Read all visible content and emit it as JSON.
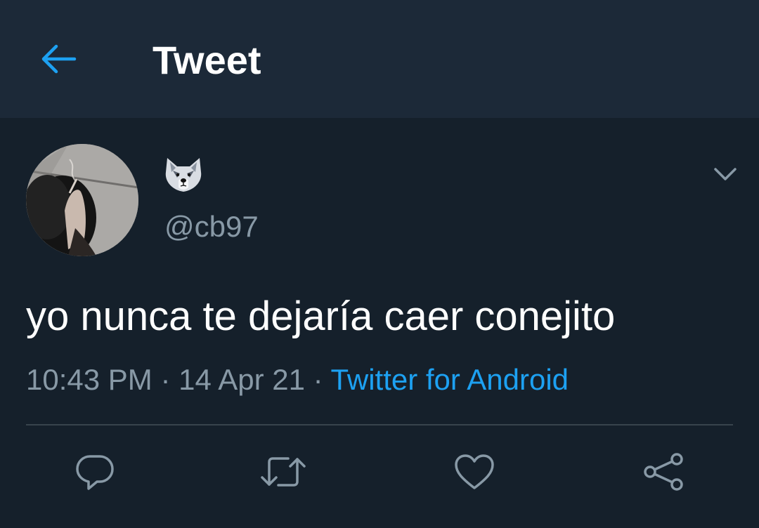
{
  "header": {
    "back_icon": "arrow-left-icon",
    "title": "Tweet"
  },
  "tweet": {
    "avatar_icon": "profile-photo",
    "display_name_icon": "wolf-face-emoji",
    "handle": "@cb97",
    "more_icon": "chevron-down-icon",
    "text": "yo nunca te dejaría caer conejito",
    "time": "10:43 PM",
    "date": "14 Apr 21",
    "separator": "·",
    "source": "Twitter for Android"
  },
  "actions": [
    {
      "name": "reply",
      "icon": "reply-icon"
    },
    {
      "name": "retweet",
      "icon": "retweet-icon"
    },
    {
      "name": "like",
      "icon": "heart-icon"
    },
    {
      "name": "share",
      "icon": "share-icon"
    }
  ],
  "colors": {
    "header_bg": "#1c2938",
    "page_bg": "#15202b",
    "accent": "#1da1f2",
    "secondary_text": "#8899a6",
    "divider": "#38444d"
  }
}
